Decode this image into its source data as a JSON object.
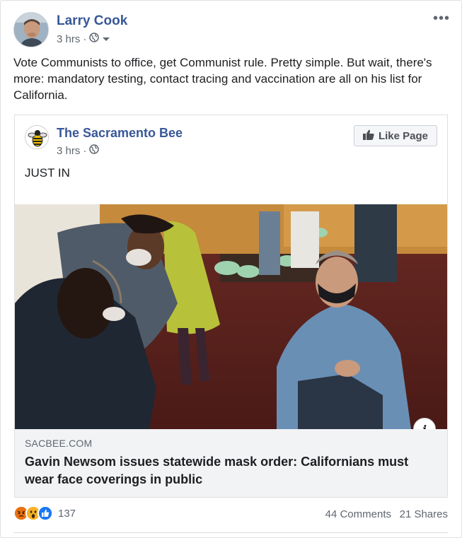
{
  "post": {
    "author": "Larry Cook",
    "time": "3 hrs",
    "privacy_icon": "globe-icon",
    "text": "Vote Communists to office, get Communist rule. Pretty simple. But wait, there's more: mandatory testing, contact tracing and vaccination are all on his list for California."
  },
  "shared": {
    "page_name": "The Sacramento Bee",
    "time": "3 hrs",
    "like_label": "Like Page",
    "text": "JUST IN",
    "link": {
      "domain": "SACBEE.COM",
      "headline": "Gavin Newsom issues statewide mask order: Californians must wear face coverings in public"
    }
  },
  "footer": {
    "reaction_count": "137",
    "comments": "44 Comments",
    "shares": "21 Shares"
  },
  "colors": {
    "link_blue": "#385898",
    "secondary_text": "#606770",
    "like_blue": "#1877f2",
    "angry": "#e9710f",
    "wow": "#f7b125"
  }
}
